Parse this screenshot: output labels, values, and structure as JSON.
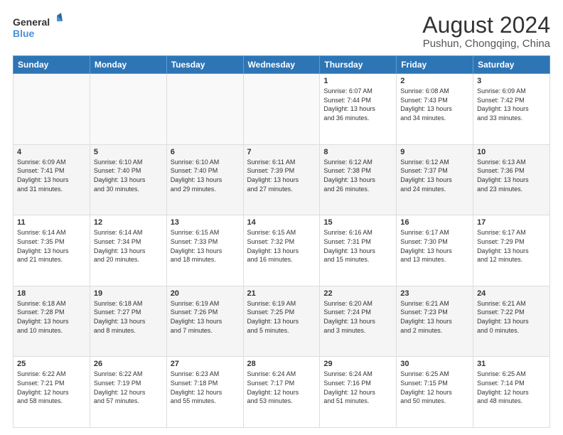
{
  "logo": {
    "line1": "General",
    "line2": "Blue"
  },
  "title": "August 2024",
  "subtitle": "Pushun, Chongqing, China",
  "weekdays": [
    "Sunday",
    "Monday",
    "Tuesday",
    "Wednesday",
    "Thursday",
    "Friday",
    "Saturday"
  ],
  "weeks": [
    [
      {
        "day": "",
        "info": ""
      },
      {
        "day": "",
        "info": ""
      },
      {
        "day": "",
        "info": ""
      },
      {
        "day": "",
        "info": ""
      },
      {
        "day": "1",
        "info": "Sunrise: 6:07 AM\nSunset: 7:44 PM\nDaylight: 13 hours\nand 36 minutes."
      },
      {
        "day": "2",
        "info": "Sunrise: 6:08 AM\nSunset: 7:43 PM\nDaylight: 13 hours\nand 34 minutes."
      },
      {
        "day": "3",
        "info": "Sunrise: 6:09 AM\nSunset: 7:42 PM\nDaylight: 13 hours\nand 33 minutes."
      }
    ],
    [
      {
        "day": "4",
        "info": "Sunrise: 6:09 AM\nSunset: 7:41 PM\nDaylight: 13 hours\nand 31 minutes."
      },
      {
        "day": "5",
        "info": "Sunrise: 6:10 AM\nSunset: 7:40 PM\nDaylight: 13 hours\nand 30 minutes."
      },
      {
        "day": "6",
        "info": "Sunrise: 6:10 AM\nSunset: 7:40 PM\nDaylight: 13 hours\nand 29 minutes."
      },
      {
        "day": "7",
        "info": "Sunrise: 6:11 AM\nSunset: 7:39 PM\nDaylight: 13 hours\nand 27 minutes."
      },
      {
        "day": "8",
        "info": "Sunrise: 6:12 AM\nSunset: 7:38 PM\nDaylight: 13 hours\nand 26 minutes."
      },
      {
        "day": "9",
        "info": "Sunrise: 6:12 AM\nSunset: 7:37 PM\nDaylight: 13 hours\nand 24 minutes."
      },
      {
        "day": "10",
        "info": "Sunrise: 6:13 AM\nSunset: 7:36 PM\nDaylight: 13 hours\nand 23 minutes."
      }
    ],
    [
      {
        "day": "11",
        "info": "Sunrise: 6:14 AM\nSunset: 7:35 PM\nDaylight: 13 hours\nand 21 minutes."
      },
      {
        "day": "12",
        "info": "Sunrise: 6:14 AM\nSunset: 7:34 PM\nDaylight: 13 hours\nand 20 minutes."
      },
      {
        "day": "13",
        "info": "Sunrise: 6:15 AM\nSunset: 7:33 PM\nDaylight: 13 hours\nand 18 minutes."
      },
      {
        "day": "14",
        "info": "Sunrise: 6:15 AM\nSunset: 7:32 PM\nDaylight: 13 hours\nand 16 minutes."
      },
      {
        "day": "15",
        "info": "Sunrise: 6:16 AM\nSunset: 7:31 PM\nDaylight: 13 hours\nand 15 minutes."
      },
      {
        "day": "16",
        "info": "Sunrise: 6:17 AM\nSunset: 7:30 PM\nDaylight: 13 hours\nand 13 minutes."
      },
      {
        "day": "17",
        "info": "Sunrise: 6:17 AM\nSunset: 7:29 PM\nDaylight: 13 hours\nand 12 minutes."
      }
    ],
    [
      {
        "day": "18",
        "info": "Sunrise: 6:18 AM\nSunset: 7:28 PM\nDaylight: 13 hours\nand 10 minutes."
      },
      {
        "day": "19",
        "info": "Sunrise: 6:18 AM\nSunset: 7:27 PM\nDaylight: 13 hours\nand 8 minutes."
      },
      {
        "day": "20",
        "info": "Sunrise: 6:19 AM\nSunset: 7:26 PM\nDaylight: 13 hours\nand 7 minutes."
      },
      {
        "day": "21",
        "info": "Sunrise: 6:19 AM\nSunset: 7:25 PM\nDaylight: 13 hours\nand 5 minutes."
      },
      {
        "day": "22",
        "info": "Sunrise: 6:20 AM\nSunset: 7:24 PM\nDaylight: 13 hours\nand 3 minutes."
      },
      {
        "day": "23",
        "info": "Sunrise: 6:21 AM\nSunset: 7:23 PM\nDaylight: 13 hours\nand 2 minutes."
      },
      {
        "day": "24",
        "info": "Sunrise: 6:21 AM\nSunset: 7:22 PM\nDaylight: 13 hours\nand 0 minutes."
      }
    ],
    [
      {
        "day": "25",
        "info": "Sunrise: 6:22 AM\nSunset: 7:21 PM\nDaylight: 12 hours\nand 58 minutes."
      },
      {
        "day": "26",
        "info": "Sunrise: 6:22 AM\nSunset: 7:19 PM\nDaylight: 12 hours\nand 57 minutes."
      },
      {
        "day": "27",
        "info": "Sunrise: 6:23 AM\nSunset: 7:18 PM\nDaylight: 12 hours\nand 55 minutes."
      },
      {
        "day": "28",
        "info": "Sunrise: 6:24 AM\nSunset: 7:17 PM\nDaylight: 12 hours\nand 53 minutes."
      },
      {
        "day": "29",
        "info": "Sunrise: 6:24 AM\nSunset: 7:16 PM\nDaylight: 12 hours\nand 51 minutes."
      },
      {
        "day": "30",
        "info": "Sunrise: 6:25 AM\nSunset: 7:15 PM\nDaylight: 12 hours\nand 50 minutes."
      },
      {
        "day": "31",
        "info": "Sunrise: 6:25 AM\nSunset: 7:14 PM\nDaylight: 12 hours\nand 48 minutes."
      }
    ]
  ]
}
